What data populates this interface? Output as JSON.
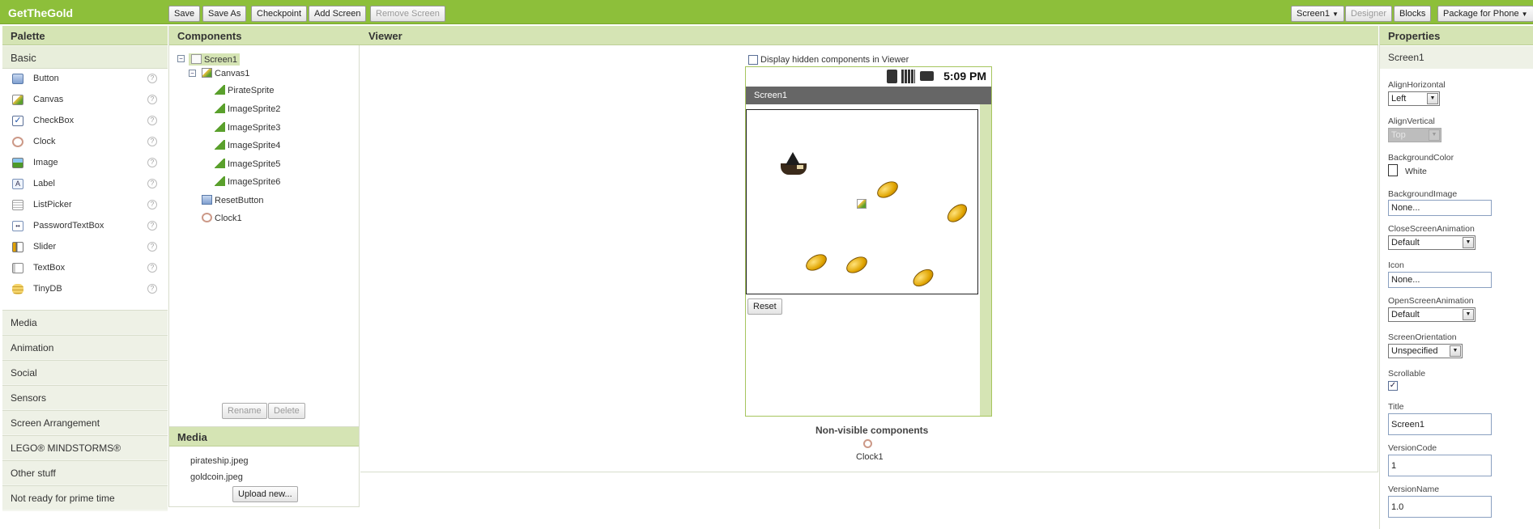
{
  "app": {
    "title": "GetTheGold"
  },
  "toolbar": {
    "save": "Save",
    "save_as": "Save As",
    "checkpoint": "Checkpoint",
    "add_screen": "Add Screen",
    "remove_screen": "Remove Screen",
    "screen_select": "Screen1",
    "designer": "Designer",
    "blocks": "Blocks",
    "package": "Package for Phone"
  },
  "palette": {
    "title": "Palette",
    "basic_label": "Basic",
    "items": [
      {
        "label": "Button",
        "icon": "button-icon"
      },
      {
        "label": "Canvas",
        "icon": "canvas-icon"
      },
      {
        "label": "CheckBox",
        "icon": "checkbox-icon"
      },
      {
        "label": "Clock",
        "icon": "clock-icon"
      },
      {
        "label": "Image",
        "icon": "image-icon"
      },
      {
        "label": "Label",
        "icon": "label-icon"
      },
      {
        "label": "ListPicker",
        "icon": "listpicker-icon"
      },
      {
        "label": "PasswordTextBox",
        "icon": "password-icon"
      },
      {
        "label": "Slider",
        "icon": "slider-icon"
      },
      {
        "label": "TextBox",
        "icon": "textbox-icon"
      },
      {
        "label": "TinyDB",
        "icon": "database-icon"
      }
    ],
    "help_glyph": "?",
    "categories": [
      "Media",
      "Animation",
      "Social",
      "Sensors",
      "Screen Arrangement",
      "LEGO® MINDSTORMS®",
      "Other stuff",
      "Not ready for prime time"
    ]
  },
  "components": {
    "title": "Components",
    "tree": {
      "screen": "Screen1",
      "canvas": "Canvas1",
      "sprites": [
        "PirateSprite",
        "ImageSprite2",
        "ImageSprite3",
        "ImageSprite4",
        "ImageSprite5",
        "ImageSprite6"
      ],
      "reset_button": "ResetButton",
      "clock": "Clock1"
    },
    "collapse_glyph": "−",
    "rename": "Rename",
    "delete": "Delete"
  },
  "media": {
    "title": "Media",
    "files": [
      "pirateship.jpeg",
      "goldcoin.jpeg"
    ],
    "upload": "Upload new..."
  },
  "viewer": {
    "title": "Viewer",
    "display_hidden": "Display hidden components in Viewer",
    "time": "5:09 PM",
    "screen_title": "Screen1",
    "reset_button": "Reset",
    "nonvisible_title": "Non-visible components",
    "nonvisible_clock": "Clock1"
  },
  "properties": {
    "title": "Properties",
    "component": "Screen1",
    "align_horizontal": {
      "label": "AlignHorizontal",
      "value": "Left"
    },
    "align_vertical": {
      "label": "AlignVertical",
      "value": "Top"
    },
    "background_color": {
      "label": "BackgroundColor",
      "value": "White",
      "color": "#ffffff"
    },
    "background_image": {
      "label": "BackgroundImage",
      "value": "None..."
    },
    "close_animation": {
      "label": "CloseScreenAnimation",
      "value": "Default"
    },
    "icon": {
      "label": "Icon",
      "value": "None..."
    },
    "open_animation": {
      "label": "OpenScreenAnimation",
      "value": "Default"
    },
    "orientation": {
      "label": "ScreenOrientation",
      "value": "Unspecified"
    },
    "scrollable": {
      "label": "Scrollable",
      "checked": true,
      "glyph": "✓"
    },
    "title_prop": {
      "label": "Title",
      "value": "Screen1"
    },
    "version_code": {
      "label": "VersionCode",
      "value": "1"
    },
    "version_name": {
      "label": "VersionName",
      "value": "1.0"
    }
  },
  "colors": {
    "accent": "#8dbf3a",
    "header": "#d5e4b4",
    "titlebar": "#666666"
  }
}
